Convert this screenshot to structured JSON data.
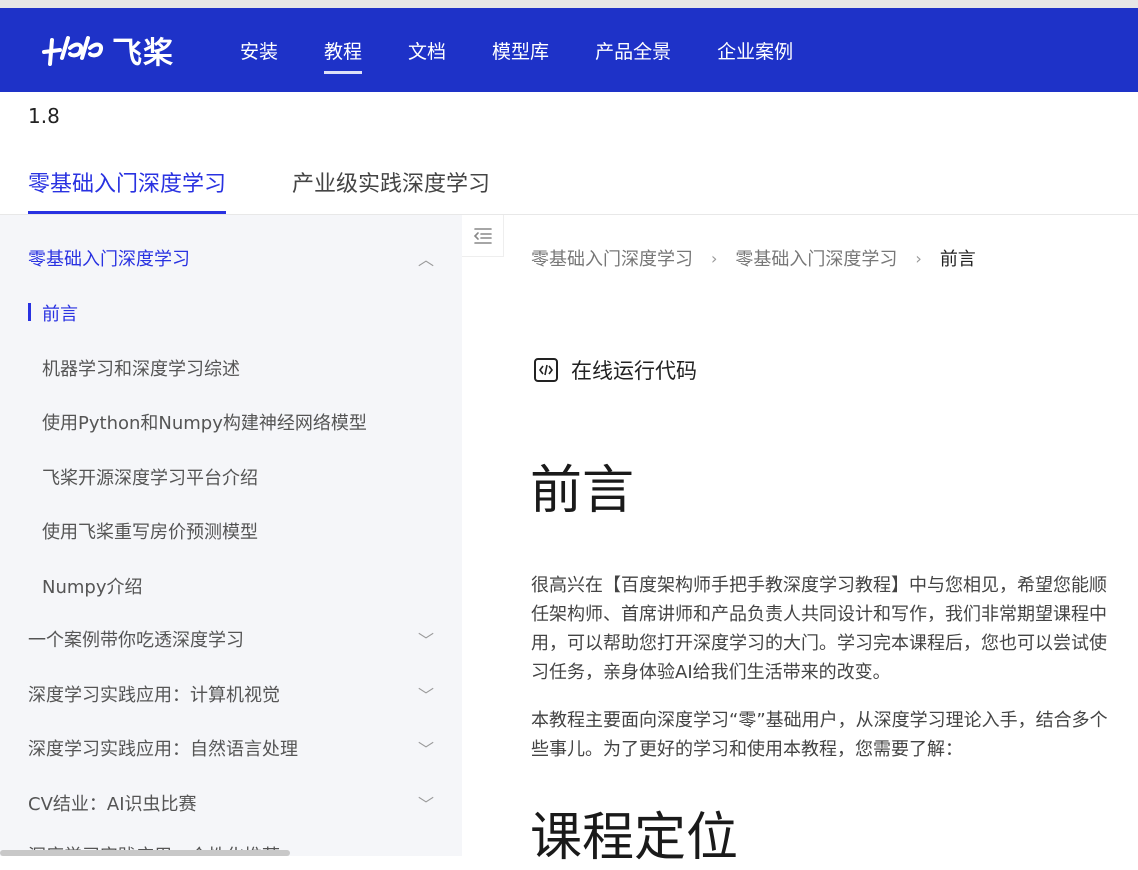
{
  "topnav": {
    "logo_text": "飞桨",
    "items": [
      "安装",
      "教程",
      "文档",
      "模型库",
      "产品全景",
      "企业案例"
    ],
    "active": "教程"
  },
  "version": "1.8",
  "tabs": [
    {
      "label": "零基础入门深度学习",
      "active": true
    },
    {
      "label": "产业级实践深度学习",
      "active": false
    }
  ],
  "sidebar": {
    "group1": "零基础入门深度学习",
    "sub_items": [
      "前言",
      "机器学习和深度学习综述",
      "使用Python和Numpy构建神经网络模型",
      "飞桨开源深度学习平台介绍",
      "使用飞桨重写房价预测模型",
      "Numpy介绍"
    ],
    "groups": [
      "一个案例带你吃透深度学习",
      "深度学习实践应用：计算机视觉",
      "深度学习实践应用：自然语言处理",
      "CV结业：AI识虫比赛",
      "深度学习实践应用：个性化推荐"
    ]
  },
  "breadcrumb": [
    "零基础入门深度学习",
    "零基础入门深度学习",
    "前言"
  ],
  "content": {
    "run_code": "在线运行代码",
    "title": "前言",
    "para1_lines": [
      "很高兴在【百度架构师手把手教深度学习教程】中与您相见，希望您能顺",
      "任架构师、首席讲师和产品负责人共同设计和写作，我们非常期望课程中",
      "用，可以帮助您打开深度学习的大门。学习完本课程后，您也可以尝试使",
      "习任务，亲身体验AI给我们生活带来的改变。"
    ],
    "para2_lines": [
      "本教程主要面向深度学习“零”基础用户，从深度学习理论入手，结合多个",
      "些事儿。为了更好的学习和使用本教程，您需要了解："
    ],
    "h2": "课程定位"
  }
}
